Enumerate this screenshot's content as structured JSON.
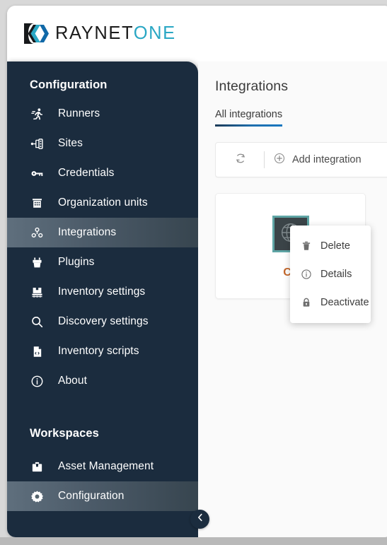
{
  "brand": {
    "logo_icon": "raynet-chevron-logo-icon",
    "name_part1": "RAYNET",
    "name_part2": "ONE",
    "name_part2_color": "#2aa7c4",
    "name_part3": "",
    "dark_color": "#1b1b1b",
    "teal_color": "#2aa7c4",
    "blue_color": "#1169a8"
  },
  "sidebar": {
    "background_color": "#1b2c3e",
    "active_item_color": "#5f6f7d",
    "configuration_heading": "Configuration",
    "workspaces_heading": "Workspaces",
    "collapse_icon": "chevron-left-icon",
    "config_items": [
      {
        "label": "Runners",
        "icon": "runner-icon",
        "active": false
      },
      {
        "label": "Sites",
        "icon": "sites-network-icon",
        "active": false
      },
      {
        "label": "Credentials",
        "icon": "key-icon",
        "active": false
      },
      {
        "label": "Organization units",
        "icon": "building-icon",
        "active": false
      },
      {
        "label": "Integrations",
        "icon": "integrations-node-icon",
        "active": true
      },
      {
        "label": "Plugins",
        "icon": "plug-box-icon",
        "active": false
      },
      {
        "label": "Inventory settings",
        "icon": "inventory-settings-icon",
        "active": false
      },
      {
        "label": "Discovery settings",
        "icon": "magnifier-icon",
        "active": false
      },
      {
        "label": "Inventory scripts",
        "icon": "script-file-icon",
        "active": false
      },
      {
        "label": "About",
        "icon": "info-circle-icon",
        "active": false
      }
    ],
    "workspace_items": [
      {
        "label": "Asset Management",
        "icon": "briefcase-icon",
        "active": false
      },
      {
        "label": "Configuration",
        "icon": "gear-icon",
        "active": true
      }
    ]
  },
  "main": {
    "page_title": "Integrations",
    "tabs": [
      {
        "label": "All integrations",
        "active": true
      }
    ],
    "tab_underline_color": "#1877c0",
    "toolbar": {
      "refresh_icon": "refresh-icon",
      "add_icon": "plus-circle-icon",
      "add_label": "Add integration"
    },
    "cards": [
      {
        "name": "Ca",
        "name_color": "#c4682c",
        "logo_icon": "globe-target-icon",
        "logo_border_color": "#5fa5a5",
        "logo_background_color": "#3b4448"
      }
    ]
  },
  "context_menu": {
    "items": [
      {
        "label": "Delete",
        "icon": "trash-icon"
      },
      {
        "label": "Details",
        "icon": "info-circle-icon"
      },
      {
        "label": "Deactivate",
        "icon": "lock-icon"
      }
    ]
  }
}
